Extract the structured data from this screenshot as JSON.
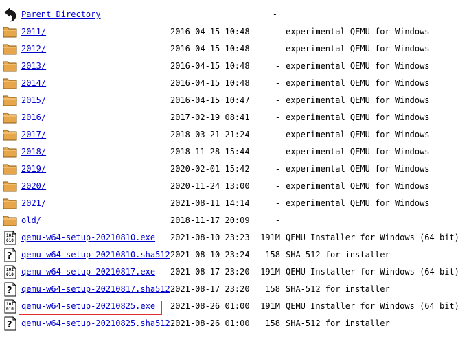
{
  "parent": {
    "label": "Parent Directory",
    "size": "-"
  },
  "entries": [
    {
      "type": "folder",
      "name": "2011/",
      "date": "2016-04-15 10:48",
      "size": "-",
      "desc": "experimental QEMU for Windows"
    },
    {
      "type": "folder",
      "name": "2012/",
      "date": "2016-04-15 10:48",
      "size": "-",
      "desc": "experimental QEMU for Windows"
    },
    {
      "type": "folder",
      "name": "2013/",
      "date": "2016-04-15 10:48",
      "size": "-",
      "desc": "experimental QEMU for Windows"
    },
    {
      "type": "folder",
      "name": "2014/",
      "date": "2016-04-15 10:48",
      "size": "-",
      "desc": "experimental QEMU for Windows"
    },
    {
      "type": "folder",
      "name": "2015/",
      "date": "2016-04-15 10:47",
      "size": "-",
      "desc": "experimental QEMU for Windows"
    },
    {
      "type": "folder",
      "name": "2016/",
      "date": "2017-02-19 08:41",
      "size": "-",
      "desc": "experimental QEMU for Windows"
    },
    {
      "type": "folder",
      "name": "2017/",
      "date": "2018-03-21 21:24",
      "size": "-",
      "desc": "experimental QEMU for Windows"
    },
    {
      "type": "folder",
      "name": "2018/",
      "date": "2018-11-28 15:44",
      "size": "-",
      "desc": "experimental QEMU for Windows"
    },
    {
      "type": "folder",
      "name": "2019/",
      "date": "2020-02-01 15:42",
      "size": "-",
      "desc": "experimental QEMU for Windows"
    },
    {
      "type": "folder",
      "name": "2020/",
      "date": "2020-11-24 13:00",
      "size": "-",
      "desc": "experimental QEMU for Windows"
    },
    {
      "type": "folder",
      "name": "2021/",
      "date": "2021-08-11 14:14",
      "size": "-",
      "desc": "experimental QEMU for Windows"
    },
    {
      "type": "folder",
      "name": "old/",
      "date": "2018-11-17 20:09",
      "size": "-",
      "desc": ""
    },
    {
      "type": "binary",
      "name": "qemu-w64-setup-20210810.exe",
      "date": "2021-08-10 23:23",
      "size": "191M",
      "desc": "QEMU Installer for Windows (64 bit)"
    },
    {
      "type": "unknown",
      "name": "qemu-w64-setup-20210810.sha512",
      "date": "2021-08-10 23:24",
      "size": "158",
      "desc": "SHA-512 for installer"
    },
    {
      "type": "binary",
      "name": "qemu-w64-setup-20210817.exe",
      "date": "2021-08-17 23:20",
      "size": "191M",
      "desc": "QEMU Installer for Windows (64 bit)"
    },
    {
      "type": "unknown",
      "name": "qemu-w64-setup-20210817.sha512",
      "date": "2021-08-17 23:20",
      "size": "158",
      "desc": "SHA-512 for installer"
    },
    {
      "type": "binary",
      "name": "qemu-w64-setup-20210825.exe",
      "date": "2021-08-26 01:00",
      "size": "191M",
      "desc": "QEMU Installer for Windows (64 bit)",
      "highlighted": true
    },
    {
      "type": "unknown",
      "name": "qemu-w64-setup-20210825.sha512",
      "date": "2021-08-26 01:00",
      "size": "158",
      "desc": "SHA-512 for installer"
    }
  ],
  "colors": {
    "link": "#0000cc",
    "highlight_border": "#e03030",
    "folder_fill": "#e8a64a",
    "folder_tab": "#f3c47a"
  },
  "icons": {
    "parent": "back-arrow-icon",
    "folder": "folder-icon",
    "binary": "binary-file-icon",
    "unknown": "unknown-file-icon"
  }
}
